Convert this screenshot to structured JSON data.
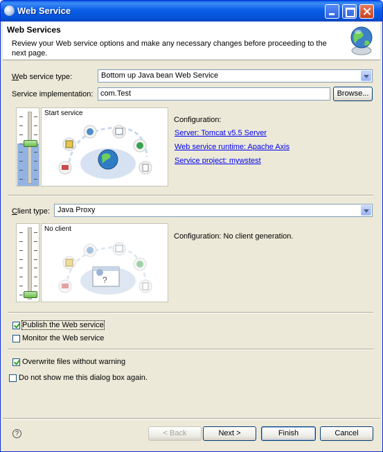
{
  "window": {
    "title": "Web Service"
  },
  "banner": {
    "title": "Web Services",
    "description": "Review your Web service options and make any necessary changes before proceeding to the next page."
  },
  "service": {
    "type_label_accel": "W",
    "type_label_rest": "eb service type:",
    "type_value": "Bottom up Java bean Web Service",
    "impl_label": "Service implementation:",
    "impl_value": "com.Test",
    "browse_label": "Browse...",
    "slider_caption": "Start service",
    "slider_level_of_7": 4,
    "config_label": "Configuration:",
    "links": {
      "server": "Server: Tomcat v5.5 Server",
      "runtime": "Web service runtime: Apache Axis",
      "project": "Service project: mywstest"
    }
  },
  "client": {
    "type_label_accel": "C",
    "type_label_rest": "lient type:",
    "type_value": "Java Proxy",
    "slider_caption": "No client",
    "slider_level_of_7": 0,
    "config_text": "Configuration: No client generation."
  },
  "options": {
    "publish_label": "Publish the Web service",
    "publish_checked": true,
    "monitor_label": "Monitor the Web service",
    "monitor_checked": false,
    "overwrite_label": "Overwrite files without warning",
    "overwrite_checked": true,
    "dont_show_label": "Do not show me this dialog box again.",
    "dont_show_checked": false
  },
  "footer": {
    "back_label": "< Back",
    "next_label": "Next >",
    "finish_label": "Finish",
    "cancel_label": "Cancel"
  },
  "icons": {
    "title": "eclipse-icon",
    "banner": "globe-wizard-icon",
    "help": "help-icon"
  }
}
